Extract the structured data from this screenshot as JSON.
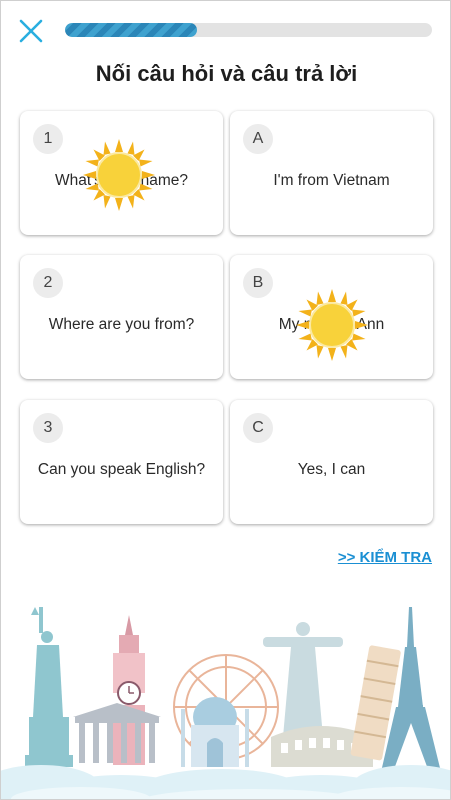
{
  "header": {
    "close_icon": "close-icon",
    "progress_fraction": 0.36
  },
  "title": "Nối câu hỏi và câu trả lời",
  "questions": [
    {
      "badge": "1",
      "text": "What's your name?"
    },
    {
      "badge": "2",
      "text": "Where are you from?"
    },
    {
      "badge": "3",
      "text": "Can you speak English?"
    }
  ],
  "answers": [
    {
      "badge": "A",
      "text": "I'm from Vietnam"
    },
    {
      "badge": "B",
      "text": "My name's Ann"
    },
    {
      "badge": "C",
      "text": "Yes, I can"
    }
  ],
  "check_link": ">> KIỂM TRA",
  "colors": {
    "accent": "#29aee0",
    "progress": "#2b86b8",
    "link": "#1a8fd3",
    "sun": "#f6c21c"
  },
  "icons": {
    "sun_markers": "sun-icon",
    "illustration": "world-landmarks-illustration"
  }
}
